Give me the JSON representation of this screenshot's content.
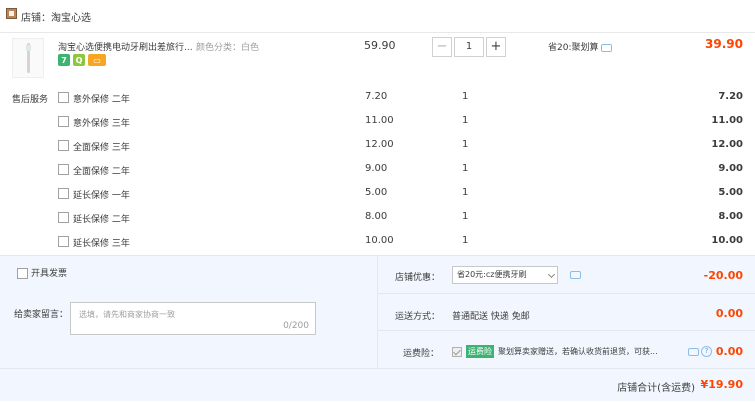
{
  "shop": {
    "label": "店铺：淘宝心选"
  },
  "item": {
    "title": "淘宝心选便携电动牙刷出差旅行...",
    "sku": "颜色分类：白色",
    "badges": [
      "7",
      "Q",
      "▭"
    ],
    "unit_price": "59.90",
    "quantity": "1",
    "qty_minus": "−",
    "qty_plus": "+",
    "saving": "省20:聚划算",
    "total": "39.90"
  },
  "services": {
    "label": "售后服务",
    "rows": [
      {
        "name": "意外保修 二年",
        "price": "7.20",
        "qty": "1",
        "total": "7.20"
      },
      {
        "name": "意外保修 三年",
        "price": "11.00",
        "qty": "1",
        "total": "11.00"
      },
      {
        "name": "全面保修 三年",
        "price": "12.00",
        "qty": "1",
        "total": "12.00"
      },
      {
        "name": "全面保修 二年",
        "price": "9.00",
        "qty": "1",
        "total": "9.00"
      },
      {
        "name": "延长保修 一年",
        "price": "5.00",
        "qty": "1",
        "total": "5.00"
      },
      {
        "name": "延长保修 二年",
        "price": "8.00",
        "qty": "1",
        "total": "8.00"
      },
      {
        "name": "延长保修 三年",
        "price": "10.00",
        "qty": "1",
        "total": "10.00"
      }
    ]
  },
  "invoice": {
    "label": "开具发票"
  },
  "message": {
    "label": "给卖家留言：",
    "placeholder": "选填，请先和商家协商一致",
    "count": "0/200"
  },
  "coupon": {
    "label": "店铺优惠：",
    "selected": "省20元:cz便携牙刷",
    "value": "-20.00"
  },
  "shipping": {
    "label": "运送方式：",
    "text": "普通配送 快递 免邮",
    "value": "0.00"
  },
  "insurance": {
    "label": "运费险：",
    "badge": "运费险",
    "text": "聚划算卖家赠送，若确认收货前退货，可获...",
    "help": "?",
    "value": "0.00"
  },
  "summary": {
    "label": "店铺合计(含运费)",
    "value": "¥19.90"
  }
}
